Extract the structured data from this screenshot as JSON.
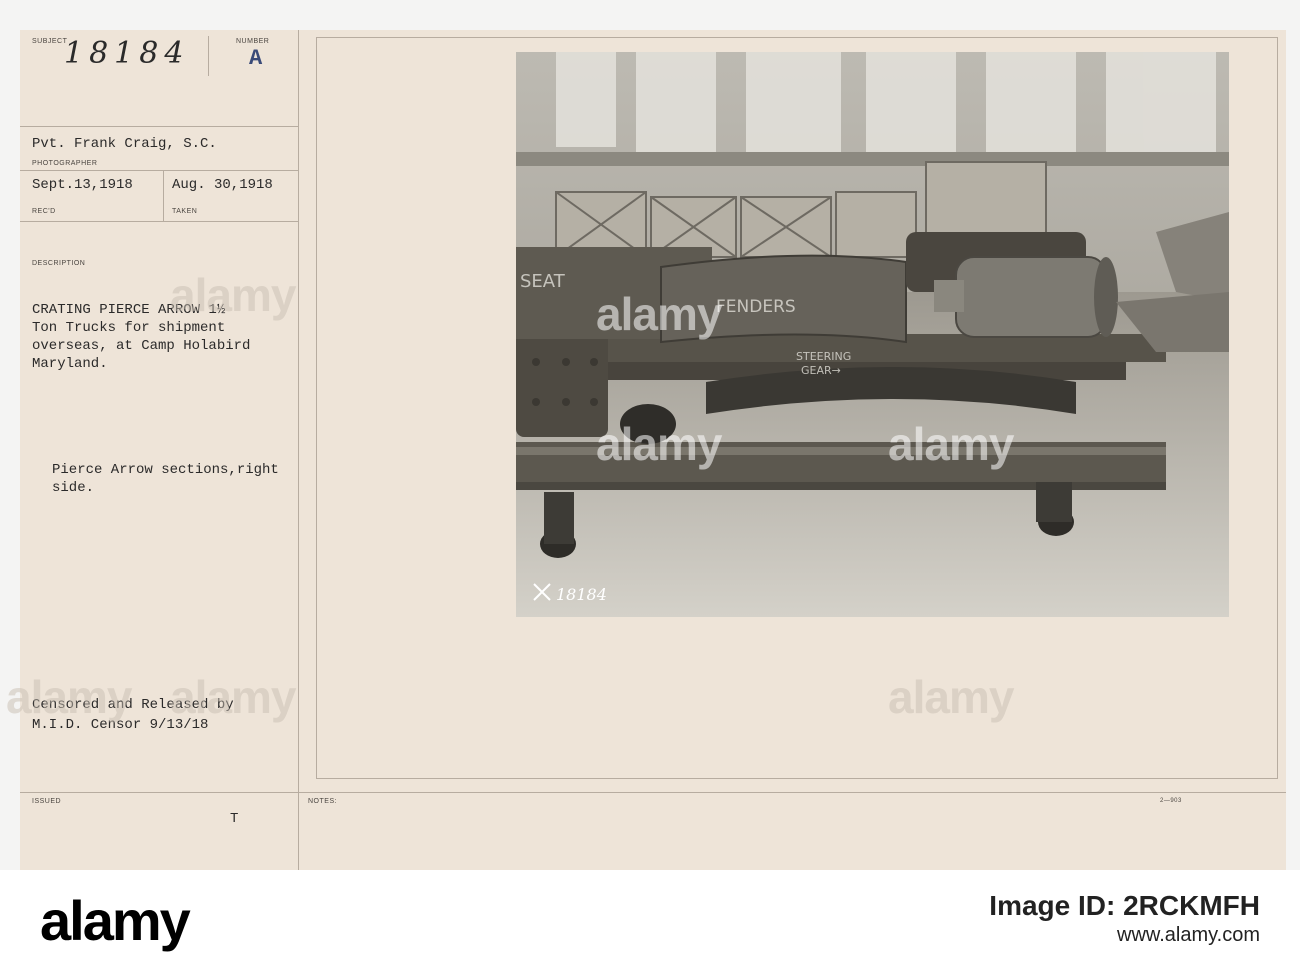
{
  "card": {
    "labels": {
      "subject": "SUBJECT",
      "number": "NUMBER",
      "photographer": "PHOTOGRAPHER",
      "recd": "REC'D",
      "taken": "TAKEN",
      "description": "DESCRIPTION",
      "issued": "ISSUED",
      "notes": "NOTES:"
    },
    "subject_number": "18184",
    "number_letter": "A",
    "photographer": "Pvt. Frank Craig, S.C.",
    "recd_date": "Sept.13,1918",
    "taken_date": "Aug. 30,1918",
    "description_lines": [
      "CRATING PIERCE ARROW 1½",
      "Ton Trucks for shipment",
      "overseas, at Camp Holabird",
      "Maryland."
    ],
    "sub_description_lines": [
      "Pierce Arrow sections,right",
      "side."
    ],
    "censor_lines": [
      "Censored and Released by",
      "M.I.D. Censor 9/13/18"
    ],
    "issued_mark": "T",
    "form_code": "2—903"
  },
  "photo": {
    "chalk_seat": "SEAT",
    "chalk_fenders": "FENDERS",
    "chalk_steering": "STEERING",
    "chalk_gear": "GEAR→",
    "negative_number": "18184"
  },
  "watermark": "alamy",
  "footer": {
    "logo": "alamy",
    "image_id": "Image ID: 2RCKMFH",
    "url": "www.alamy.com"
  }
}
